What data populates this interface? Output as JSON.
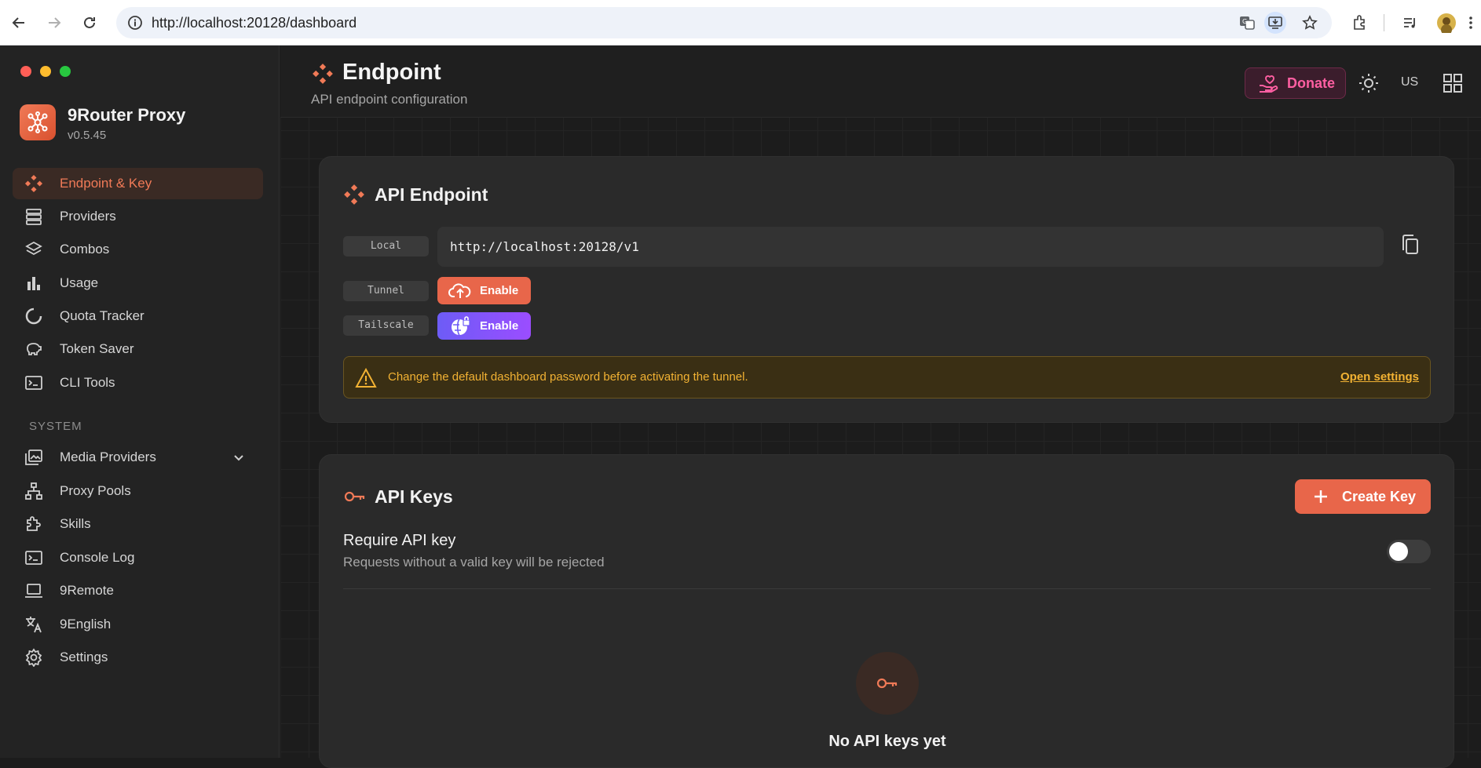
{
  "browser": {
    "url": "http://localhost:20128/dashboard"
  },
  "sidebar": {
    "brand_name": "9Router Proxy",
    "version": "v0.5.45",
    "items": [
      {
        "label": "Endpoint & Key",
        "icon": "endpoint-icon",
        "active": true
      },
      {
        "label": "Providers",
        "icon": "server-icon"
      },
      {
        "label": "Combos",
        "icon": "layers-icon"
      },
      {
        "label": "Usage",
        "icon": "bar-chart-icon"
      },
      {
        "label": "Quota Tracker",
        "icon": "gauge-icon"
      },
      {
        "label": "Token Saver",
        "icon": "piggy-bank-icon"
      },
      {
        "label": "CLI Tools",
        "icon": "terminal-icon"
      }
    ],
    "system_label": "SYSTEM",
    "system_items": [
      {
        "label": "Media Providers",
        "icon": "media-icon"
      },
      {
        "label": "Proxy Pools",
        "icon": "network-icon"
      },
      {
        "label": "Skills",
        "icon": "puzzle-icon"
      },
      {
        "label": "Console Log",
        "icon": "console-icon"
      },
      {
        "label": "9Remote",
        "icon": "laptop-icon"
      },
      {
        "label": "9English",
        "icon": "translate-icon"
      },
      {
        "label": "Settings",
        "icon": "gear-icon"
      }
    ]
  },
  "header": {
    "title": "Endpoint",
    "subtitle": "API endpoint configuration",
    "donate_label": "Donate",
    "locale": "US"
  },
  "endpoint_card": {
    "title": "API Endpoint",
    "local_tag": "Local",
    "local_url": "http://localhost:20128/v1",
    "tunnel_tag": "Tunnel",
    "tunnel_button": "Enable",
    "tailscale_tag": "Tailscale",
    "tailscale_button": "Enable",
    "warning": "Change the default dashboard password before activating the tunnel.",
    "warning_link": "Open settings"
  },
  "keys_card": {
    "title": "API Keys",
    "create_button": "Create Key",
    "require_title": "Require API key",
    "require_subtitle": "Requests without a valid key will be rejected",
    "require_enabled": false,
    "empty_title": "No API keys yet"
  },
  "colors": {
    "accent": "#e8664a",
    "tailscale": "#8b5cf6",
    "warning": "#f2b233",
    "donate": "#ff5fa2"
  }
}
